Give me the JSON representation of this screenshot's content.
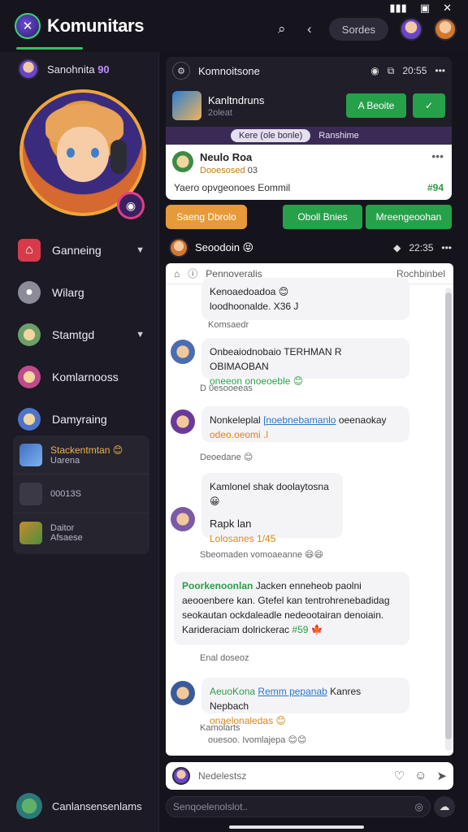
{
  "app": {
    "title": "Komunitars"
  },
  "topbar": {
    "status_icons": [
      "signal-icon",
      "battery-icon",
      "close-icon"
    ],
    "pill_label": "Sordes"
  },
  "sidebar": {
    "user": {
      "name": "Sanohnita",
      "badge": "90"
    },
    "nav": [
      {
        "label": "Ganneing",
        "icon": "home-icon",
        "color": "#d83a4a",
        "chevron": true
      },
      {
        "label": "Wilarg",
        "icon": "person-icon",
        "color": "#8c8c98",
        "chevron": false
      },
      {
        "label": "Stamtgd",
        "icon": "avatar-icon",
        "color": "#6e9f6a",
        "chevron": true
      },
      {
        "label": "Komlarnooss",
        "icon": "avatar-icon",
        "color": "#c24a8c",
        "chevron": false
      },
      {
        "label": "Damyraing",
        "icon": "avatar-icon",
        "color": "#4d74c9",
        "chevron": false
      }
    ],
    "card": [
      {
        "title": "Stackentmtan 😊",
        "sub": "Uarena"
      },
      {
        "title": "00013S",
        "sub": ""
      },
      {
        "title": "Daitor",
        "sub": "Afsaese"
      }
    ],
    "footer": {
      "label": "Canlansensenlams"
    }
  },
  "conversation": {
    "title": "Komnoitsone",
    "time": "20:55",
    "game": {
      "title": "Kanltndruns",
      "sub": "2oleat",
      "btn1": "A Beoite",
      "btn2": "✓"
    },
    "tabs": {
      "active": "Kere (ole bonle)",
      "other": "Ranshime"
    },
    "notification": {
      "name": "Neulo Roa",
      "sub": "Dooesosed",
      "sub_extra": "03",
      "text": "Yaero opvgeonoes Eommil",
      "count": "#94"
    },
    "actions": [
      "Saeng Dbrolo",
      "Oboll Bnies",
      "Mreengeoohan"
    ],
    "section": {
      "title": "Seoodoin 😝",
      "time": "22:35"
    }
  },
  "chat": {
    "toolbar": {
      "left": "Pennoveralis",
      "right": "Rochbinbel"
    },
    "messages": [
      {
        "line1": "Kenoaedoadoa 😊",
        "line2": "loodhoonalde. X36 J"
      },
      {
        "meta": "Komsaedr"
      },
      {
        "text": "Onbeaiodnobaio TERHMAN R OBIMAOBAN",
        "sub": "oneeon onoeoeble 😊"
      },
      {
        "meta": "D 0esooeeas"
      },
      {
        "name": "Nonkeleplal",
        "link": "[noebnebamanlo",
        "tail": "oeenaokay",
        "sub": "odeo.oeomi .l"
      },
      {
        "meta": "Deoedane 😊"
      },
      {
        "text": "Kamlonel shak doolaytosna 😀",
        "name": "Rapk lan",
        "sub": "Lolosanes 1/45"
      },
      {
        "meta": "Sbeomaden vomoaeanne 😄😄"
      },
      {
        "text1": "Poorkenoonlan",
        "text1b": "Jacken enneheob paolni",
        "text2": "aeooenbere kan. Gtefel kan tentrohrenebadidag",
        "text3": "seokautan ockdaleadle nedeootairan denoiain.",
        "text4": "Karideraciam dolrickerac",
        "text4b": "#59 🍁"
      },
      {
        "meta": "Enal doseoz"
      },
      {
        "name": "AeuoKona",
        "link": "Remm pepanab",
        "tail": "Kanres Nepbach",
        "sub": "onaelonaledas 😊"
      },
      {
        "meta1": "Kamolarts",
        "meta2": "ouesoo. Ivomlajepa 😊😊"
      }
    ]
  },
  "composer": {
    "placeholder": "Nedelestsz"
  },
  "search": {
    "placeholder": "Senqoelenolslot.."
  }
}
